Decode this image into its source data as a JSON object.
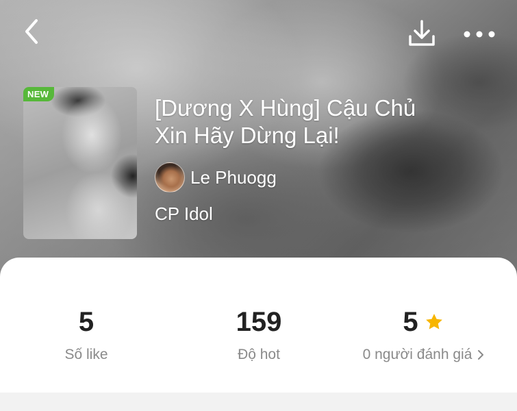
{
  "header": {
    "back_icon": "chevron-left-icon",
    "download_icon": "download-icon",
    "more_icon": "more-horizontal-icon"
  },
  "book": {
    "badge": "NEW",
    "title_line1": "[Dương X Hùng] Cậu Chủ",
    "title_line2": "Xin Hãy Dừng Lại!",
    "author": "Le Phuogg",
    "category": "CP Idol"
  },
  "stats": {
    "likes_value": "5",
    "likes_label": "Số like",
    "hot_value": "159",
    "hot_label": "Độ hot",
    "rating_value": "5",
    "rating_label": "0 người đánh giá",
    "rating_star_color": "#f7b500"
  },
  "colors": {
    "badge_green": "#57b83a",
    "text_dark": "#222222",
    "text_muted": "#8a8a8a"
  }
}
